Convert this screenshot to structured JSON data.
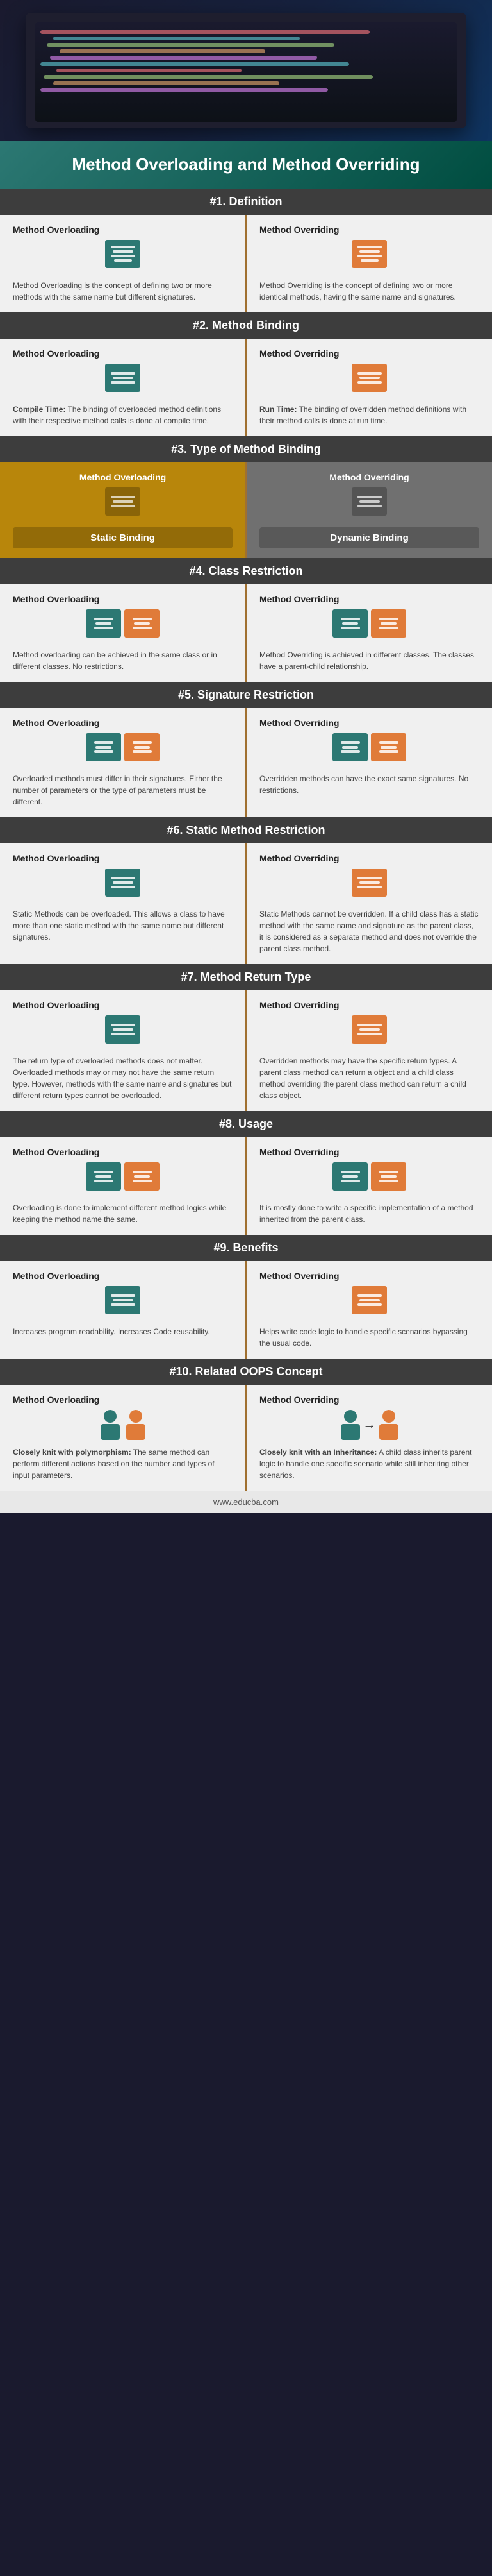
{
  "page": {
    "title": "Method Overloading and Method Overriding",
    "website": "www.educba.com"
  },
  "sections": [
    {
      "id": "definition",
      "header": "#1. Definition",
      "left": {
        "title": "Method Overloading",
        "text": "Method Overloading is the concept of defining two or more methods with the same name but different signatures.",
        "icon_color": "teal"
      },
      "right": {
        "title": "Method Overriding",
        "text": "Method Overriding is the concept of defining two or more identical methods, having the same name and signatures.",
        "icon_color": "orange"
      }
    },
    {
      "id": "binding",
      "header": "#2. Method Binding",
      "left": {
        "title": "Method Overloading",
        "text": "Compile Time: The binding of overloaded method definitions with their respective method calls is done at compile time.",
        "highlight": "Compile Time:",
        "icon_color": "teal"
      },
      "right": {
        "title": "Method Overriding",
        "text": "Run Time: The binding of overridden method definitions with their method calls is done at run time.",
        "highlight": "Run Time:",
        "icon_color": "orange"
      }
    },
    {
      "id": "type-binding",
      "header": "#3. Type of Method Binding",
      "left": {
        "title": "Method Overloading",
        "label": "Static Binding",
        "bg": "gold"
      },
      "right": {
        "title": "Method Overriding",
        "label": "Dynamic Binding",
        "bg": "gray"
      }
    },
    {
      "id": "class-restriction",
      "header": "#4. Class Restriction",
      "left": {
        "title": "Method Overloading",
        "text": "Method overloading can be achieved in the same class or in different classes. No restrictions.",
        "icon_color": "teal"
      },
      "right": {
        "title": "Method Overriding",
        "text": "Method Overriding is achieved in different classes. The classes have a parent-child relationship.",
        "icon_color": "orange"
      }
    },
    {
      "id": "signature-restriction",
      "header": "#5. Signature Restriction",
      "left": {
        "title": "Method Overloading",
        "text": "Overloaded methods must differ in their signatures. Either the number of parameters or the type of parameters must be different.",
        "icon_color": "teal"
      },
      "right": {
        "title": "Method Overriding",
        "text": "Overridden methods can have the exact same signatures. No restrictions.",
        "icon_color": "orange"
      }
    },
    {
      "id": "static-method",
      "header": "#6. Static Method Restriction",
      "left": {
        "title": "Method Overloading",
        "text": "Static Methods can be overloaded. This allows a class to have more than one static method with the same name but different signatures.",
        "icon_color": "teal"
      },
      "right": {
        "title": "Method Overriding",
        "text": "Static Methods cannot be overridden. If a child class has a static method with the same name and signature as the parent class, it is considered as a separate method and does not override the parent class method.",
        "icon_color": "orange"
      }
    },
    {
      "id": "return-type",
      "header": "#7. Method Return Type",
      "left": {
        "title": "Method Overloading",
        "text": "The return type of overloaded methods does not matter. Overloaded methods may or may not have the same return type. However, methods with the same name and signatures but different return types cannot be overloaded.",
        "icon_color": "teal"
      },
      "right": {
        "title": "Method Overriding",
        "text": "Overridden methods may have the specific return types. A parent class method can return a object and a child class method overriding the parent class method can return a child class object.",
        "icon_color": "orange"
      }
    },
    {
      "id": "usage",
      "header": "#8. Usage",
      "left": {
        "title": "Method Overloading",
        "text": "Overloading is done to implement different method logics while keeping the method name the same.",
        "icon_color": "teal"
      },
      "right": {
        "title": "Method Overriding",
        "text": "It is mostly done to write a specific implementation of a method inherited from the parent class.",
        "icon_color": "orange"
      }
    },
    {
      "id": "benefits",
      "header": "#9. Benefits",
      "left": {
        "title": "Method Overloading",
        "text": "Increases program readability. Increases Code reusability.",
        "icon_color": "teal"
      },
      "right": {
        "title": "Method Overriding",
        "text": "Helps write code logic to handle specific scenarios bypassing the usual code.",
        "icon_color": "orange"
      }
    },
    {
      "id": "oops",
      "header": "#10. Related OOPS Concept",
      "left": {
        "title": "Method Overloading",
        "text": "Closely knit with polymorphism: The same method can perform different actions based on the number and types of input parameters.",
        "icon_color": "teal"
      },
      "right": {
        "title": "Method Overriding",
        "text": "Closely knit with an Inheritance: A child class inherits parent logic to handle one specific scenario while still inheriting other scenarios.",
        "icon_color": "orange"
      }
    }
  ]
}
